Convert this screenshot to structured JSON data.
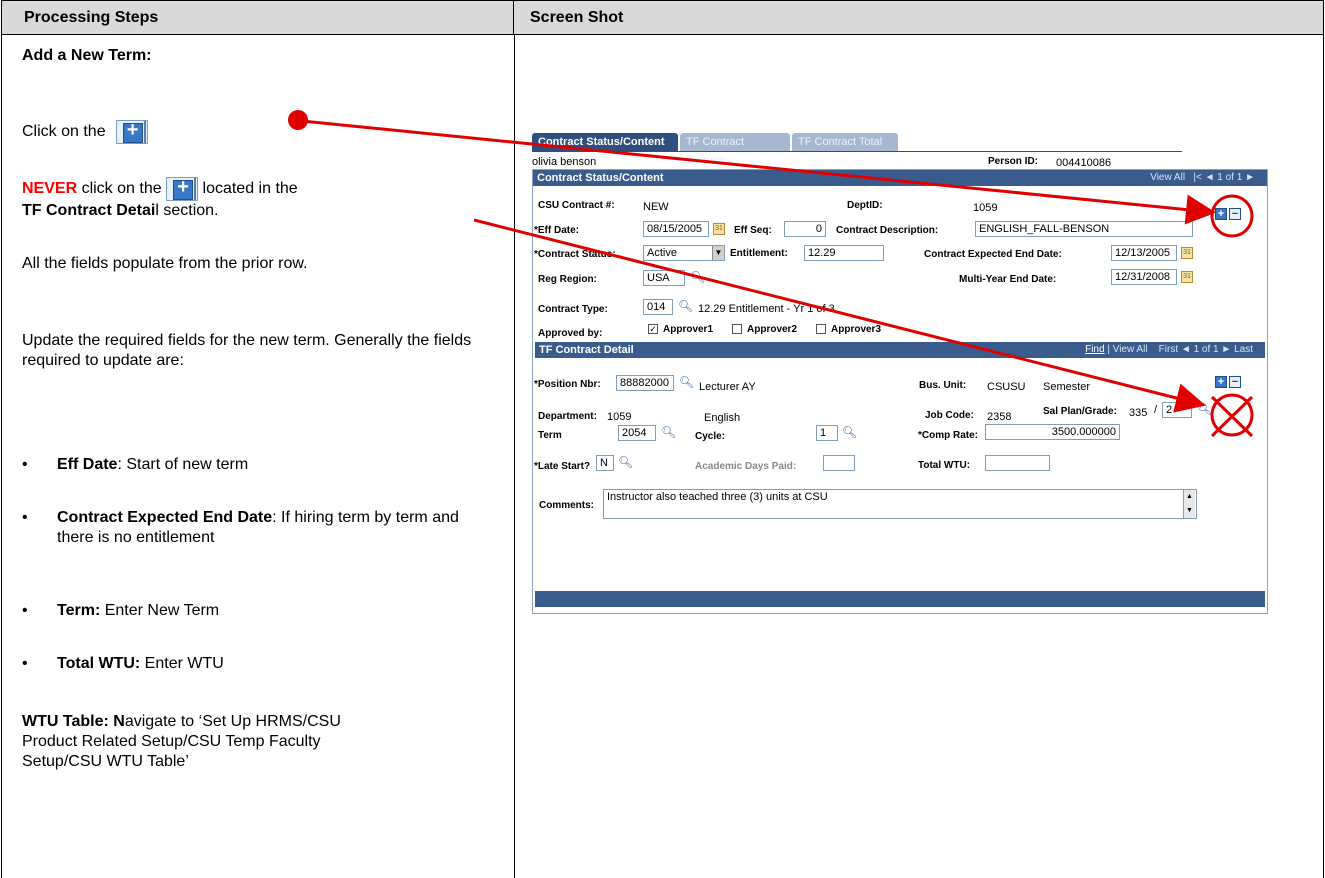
{
  "headers": {
    "left": "Processing Steps",
    "right": "Screen Shot"
  },
  "steps": {
    "title": "Add a New Term:",
    "click_on": "Click on the",
    "never_word": "NEVER",
    "never_rest1": " click on the ",
    "never_rest2": " located in the",
    "never_section": "TF Contract Detai",
    "never_section_end": "l section.",
    "populate": "All the fields populate from the prior row.",
    "update": "Update the required fields for the new term.  Generally the fields required to update are:",
    "bullets": [
      {
        "label": "Eff Date",
        "text": ":  Start of new term"
      },
      {
        "label": "Contract Expected End Date",
        "text": ":  If hiring term by term and there is no entitlement"
      },
      {
        "label": "Term:",
        "text": " Enter New Term"
      },
      {
        "label": "Total WTU:",
        "text": "  Enter WTU"
      }
    ],
    "wtu_label": "WTU Table:",
    "wtu_n": " N",
    "wtu_text": "avigate to ‘Set Up HRMS/CSU Product Related Setup/CSU Temp Faculty Setup/CSU WTU Table’"
  },
  "shot": {
    "tabs": [
      "Contract Status/Content",
      "TF Contract Courses",
      "TF Contract Total"
    ],
    "person_name": "olivia benson",
    "person_id_label": "Person ID:",
    "person_id": "004410086",
    "status_bar": {
      "title": "Contract Status/Content",
      "view_all": "View All",
      "nav": "1 of 1"
    },
    "csu_contract_label": "CSU Contract #:",
    "csu_contract": "NEW",
    "deptid_label": "DeptID:",
    "deptid": "1059",
    "eff_date_label": "*Eff Date:",
    "eff_date": "08/15/2005",
    "eff_seq_label": "Eff Seq:",
    "eff_seq": "0",
    "contract_desc_label": "Contract Description:",
    "contract_desc": "ENGLISH_FALL-BENSON",
    "contract_status_label": "*Contract Status:",
    "contract_status": "Active",
    "entitlement_label": "Entitlement:",
    "entitlement": "12.29",
    "exp_end_label": "Contract Expected End Date:",
    "exp_end": "12/13/2005",
    "reg_region_label": "Reg Region:",
    "reg_region": "USA",
    "multi_year_label": "Multi-Year End Date:",
    "multi_year": "12/31/2008",
    "contract_type_label": "Contract Type:",
    "contract_type": "014",
    "contract_type_desc": "12.29 Entitlement - Yr 1 of 3",
    "approved_by_label": "Approved by:",
    "approvers": [
      "Approver1",
      "Approver2",
      "Approver3"
    ],
    "detail_bar": {
      "title": "TF Contract Detail",
      "find": "Find",
      "view_all": "View All",
      "first": "First",
      "nav": "1 of 1",
      "last": "Last"
    },
    "position_label": "*Position Nbr:",
    "position": "88882000",
    "position_desc": "Lecturer AY",
    "bus_unit_label": "Bus. Unit:",
    "bus_unit": "CSUSU",
    "bus_unit_desc": "Semester",
    "department_label": "Department:",
    "department": "1059",
    "department_desc": "English",
    "job_code_label": "Job Code:",
    "job_code": "2358",
    "sal_plan_label": "Sal Plan/Grade:",
    "sal_plan": "335",
    "grade": "2",
    "term_label": "Term",
    "term": "2054",
    "cycle_label": "Cycle:",
    "cycle": "1",
    "comp_rate_label": "*Comp Rate:",
    "comp_rate": "3500.000000",
    "late_start_label": "*Late Start?",
    "late_start": "N",
    "academic_days_label": "Academic Days Paid:",
    "total_wtu_label": "Total WTU:",
    "comments_label": "Comments:",
    "comments": "Instructor also teached three (3) units at CSU"
  },
  "colors": {
    "arrow": "#e00000",
    "header_bg": "#d9d9d9",
    "ps_bar": "#3a5c8d"
  }
}
